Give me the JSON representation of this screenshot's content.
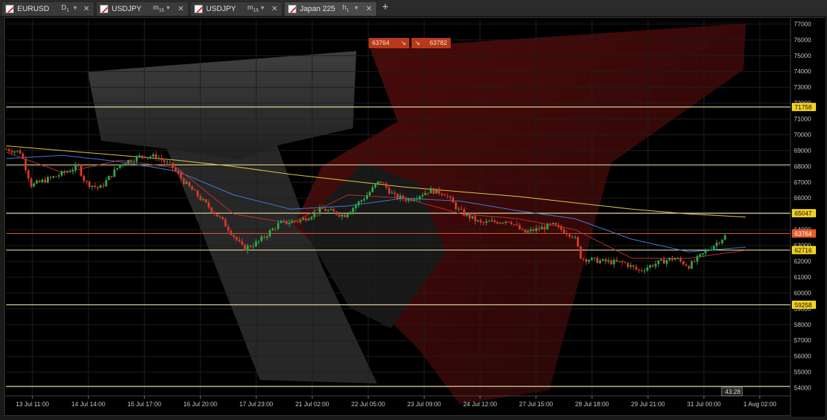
{
  "tabs": [
    {
      "symbol": "EURUSD",
      "timeframe": "D",
      "timeframe_sub": "1",
      "active": false
    },
    {
      "symbol": "USDJPY",
      "timeframe": "m",
      "timeframe_sub": "15",
      "active": false
    },
    {
      "symbol": "USDJPY",
      "timeframe": "m",
      "timeframe_sub": "15",
      "active": false
    },
    {
      "symbol": "Japan 225",
      "timeframe": "h",
      "timeframe_sub": "1",
      "active": true
    }
  ],
  "add_tab": "+",
  "price_chips": {
    "bid": "63764",
    "ask": "63782"
  },
  "colors": {
    "bull": "#2ea84a",
    "bear": "#d63a2a",
    "ma_yellow": "#e6d24a",
    "ma_blue": "#3f7fe0",
    "ma_cyan": "#3fb0b0",
    "ma_red": "#c03030",
    "ma_purple": "#8040c0",
    "hline": "#e8d9a0",
    "current": "#e85a28"
  },
  "chart_data": {
    "type": "candlestick",
    "y_range": [
      53500,
      77300
    ],
    "y_ticks": [
      "77000",
      "76000",
      "75000",
      "74000",
      "73000",
      "72000",
      "71000",
      "70000",
      "69000",
      "68000",
      "67000",
      "66000",
      "65000",
      "64000",
      "63000",
      "62000",
      "61000",
      "60000",
      "59000",
      "58000",
      "57000",
      "56000",
      "55000",
      "54000"
    ],
    "x_labels": [
      "13 Jul 11:00",
      "14 Jul 14:00",
      "15 Jul 17:00",
      "16 Jul 20:00",
      "17 Jul 23:00",
      "21 Jul 02:00",
      "22 Jul 05:00",
      "23 Jul 09:00",
      "24 Jul 12:00",
      "27 Jul 15:00",
      "28 Jul 18:00",
      "29 Jul 21:00",
      "31 Jul 00:00",
      "1 Aug 02:00"
    ],
    "horizontal_levels": [
      {
        "value": 71758,
        "label": "71758"
      },
      {
        "value": 68100,
        "label": ""
      },
      {
        "value": 65047,
        "label": "65047"
      },
      {
        "value": 62716,
        "label": "62716"
      },
      {
        "value": 59258,
        "label": "59258"
      },
      {
        "value": 54100,
        "label": ""
      }
    ],
    "current_price": {
      "value": 63764,
      "label": "63764"
    },
    "countdown": "43:28",
    "close_path": [
      69100,
      68900,
      66800,
      67400,
      68000,
      67000,
      66600,
      68200,
      68700,
      68600,
      68000,
      66900,
      64600,
      62800,
      63200,
      64400,
      64600,
      65300,
      64900,
      66100,
      67100,
      66100,
      65900,
      66500,
      66300,
      65200,
      64400,
      64600,
      63800,
      64300,
      63600,
      62200,
      62000,
      61900,
      61400,
      61800,
      62100,
      62200,
      61700,
      62500,
      63600,
      63800
    ],
    "close_path_x": [
      0,
      0.02,
      0.035,
      0.07,
      0.1,
      0.11,
      0.13,
      0.16,
      0.19,
      0.21,
      0.23,
      0.25,
      0.3,
      0.33,
      0.35,
      0.38,
      0.41,
      0.44,
      0.47,
      0.5,
      0.52,
      0.54,
      0.56,
      0.59,
      0.61,
      0.63,
      0.66,
      0.7,
      0.72,
      0.76,
      0.79,
      0.8,
      0.83,
      0.86,
      0.88,
      0.9,
      0.92,
      0.93,
      0.95,
      0.97,
      1.0,
      1.02
    ],
    "ma_yellow": [
      69300,
      69000,
      68700,
      68400,
      68000,
      67500,
      67100,
      66700,
      66400,
      66100,
      65700,
      65300,
      65000,
      64800
    ],
    "ma_blue": [
      68500,
      68700,
      68300,
      67700,
      66200,
      65300,
      65500,
      66000,
      65800,
      65200,
      64700,
      63400,
      62600,
      62900
    ],
    "ma_red": [
      68900,
      67600,
      68400,
      67900,
      65000,
      64400,
      66200,
      66000,
      65000,
      64700,
      64000,
      62200,
      62200,
      62700
    ]
  }
}
